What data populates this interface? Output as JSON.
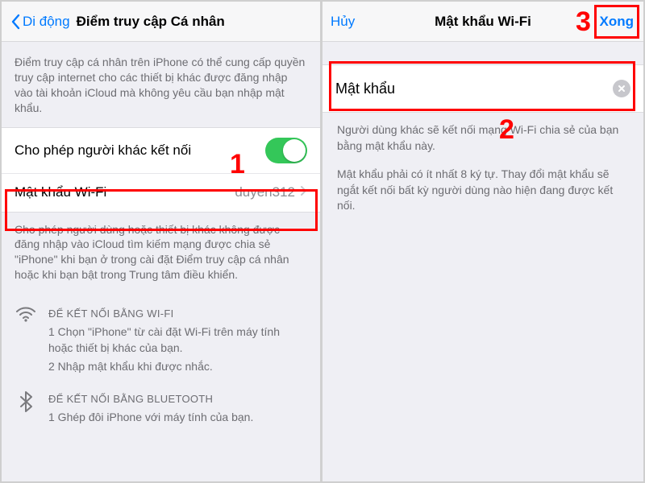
{
  "left": {
    "nav": {
      "back": "Di động",
      "title": "Điểm truy cập Cá nhân"
    },
    "intro": "Điểm truy cập cá nhân trên iPhone có thể cung cấp quyền truy cập internet cho các thiết bị khác được đăng nhập vào tài khoản iCloud mà không yêu cầu bạn nhập mật khẩu.",
    "allow_others": "Cho phép người khác kết nối",
    "wifi_password": {
      "label": "Mật khẩu Wi-Fi",
      "value": "duyen312"
    },
    "footer": "Cho phép người dùng hoặc thiết bị khác không được đăng nhập vào iCloud tìm kiếm mạng được chia sẻ \"iPhone\" khi bạn ở trong cài đặt Điểm truy cập cá nhân hoặc khi bạn bật trong Trung tâm điều khiển.",
    "wifi_how": {
      "title": "ĐỂ KẾT NỐI BẰNG WI-FI",
      "s1": "1 Chọn \"iPhone\" từ cài đặt Wi-Fi trên máy tính hoặc thiết bị khác của bạn.",
      "s2": "2 Nhập mật khẩu khi được nhắc."
    },
    "bt_how": {
      "title": "ĐỂ KẾT NỐI BẰNG BLUETOOTH",
      "s1": "1 Ghép đôi iPhone với máy tính của bạn."
    }
  },
  "right": {
    "nav": {
      "cancel": "Hủy",
      "title": "Mật khẩu Wi-Fi",
      "done": "Xong"
    },
    "password_label": "Mật khẩu",
    "help1": "Người dùng khác sẽ kết nối mạng Wi-Fi chia sẻ của bạn bằng mật khẩu này.",
    "help2": "Mật khẩu phải có ít nhất 8 ký tự. Thay đổi mật khẩu sẽ ngắt kết nối bất kỳ người dùng nào hiện đang được kết nối."
  },
  "steps": {
    "one": "1",
    "two": "2",
    "three": "3"
  }
}
